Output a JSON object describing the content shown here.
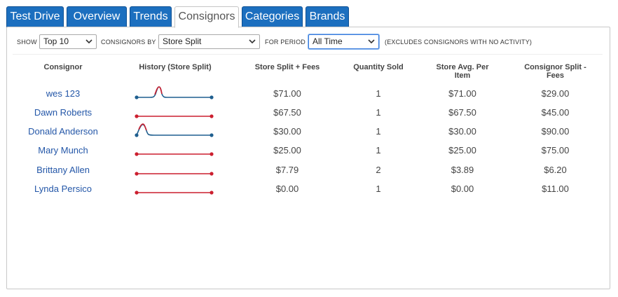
{
  "tabs": [
    {
      "label": "Test Drive",
      "active": false
    },
    {
      "label": "Overview",
      "active": false
    },
    {
      "label": "Trends",
      "active": false
    },
    {
      "label": "Consignors",
      "active": true
    },
    {
      "label": "Categories",
      "active": false
    },
    {
      "label": "Brands",
      "active": false
    }
  ],
  "toolbar": {
    "show_label": "SHOW",
    "show_value": "Top 10",
    "by_label": "CONSIGNORS BY",
    "by_value": "Store Split",
    "period_label": "FOR PERIOD",
    "period_value": "All Time",
    "note": "(EXCLUDES CONSIGNORS WITH NO ACTIVITY)"
  },
  "table": {
    "headers": [
      "Consignor",
      "History (Store Split)",
      "Store Split + Fees",
      "Quantity Sold",
      "Store Avg. Per Item",
      "Consignor Split - Fees"
    ],
    "rows": [
      {
        "consignor": "wes 123",
        "store_split": "$71.00",
        "qty": "1",
        "avg": "$71.00",
        "consignor_split": "$29.00",
        "spark": "peak1"
      },
      {
        "consignor": "Dawn Roberts",
        "store_split": "$67.50",
        "qty": "1",
        "avg": "$67.50",
        "consignor_split": "$45.00",
        "spark": "flat"
      },
      {
        "consignor": "Donald Anderson",
        "store_split": "$30.00",
        "qty": "1",
        "avg": "$30.00",
        "consignor_split": "$90.00",
        "spark": "peak2"
      },
      {
        "consignor": "Mary Munch",
        "store_split": "$25.00",
        "qty": "1",
        "avg": "$25.00",
        "consignor_split": "$75.00",
        "spark": "flat"
      },
      {
        "consignor": "Brittany Allen",
        "store_split": "$7.79",
        "qty": "2",
        "avg": "$3.89",
        "consignor_split": "$6.20",
        "spark": "flat"
      },
      {
        "consignor": "Lynda Persico",
        "store_split": "$0.00",
        "qty": "1",
        "avg": "$0.00",
        "consignor_split": "$11.00",
        "spark": "flat"
      }
    ]
  },
  "colors": {
    "tab_blue": "#1c6fbf",
    "link_blue": "#2457a8",
    "spark_blue": "#1f5f8f",
    "spark_red": "#cc1f2f"
  }
}
